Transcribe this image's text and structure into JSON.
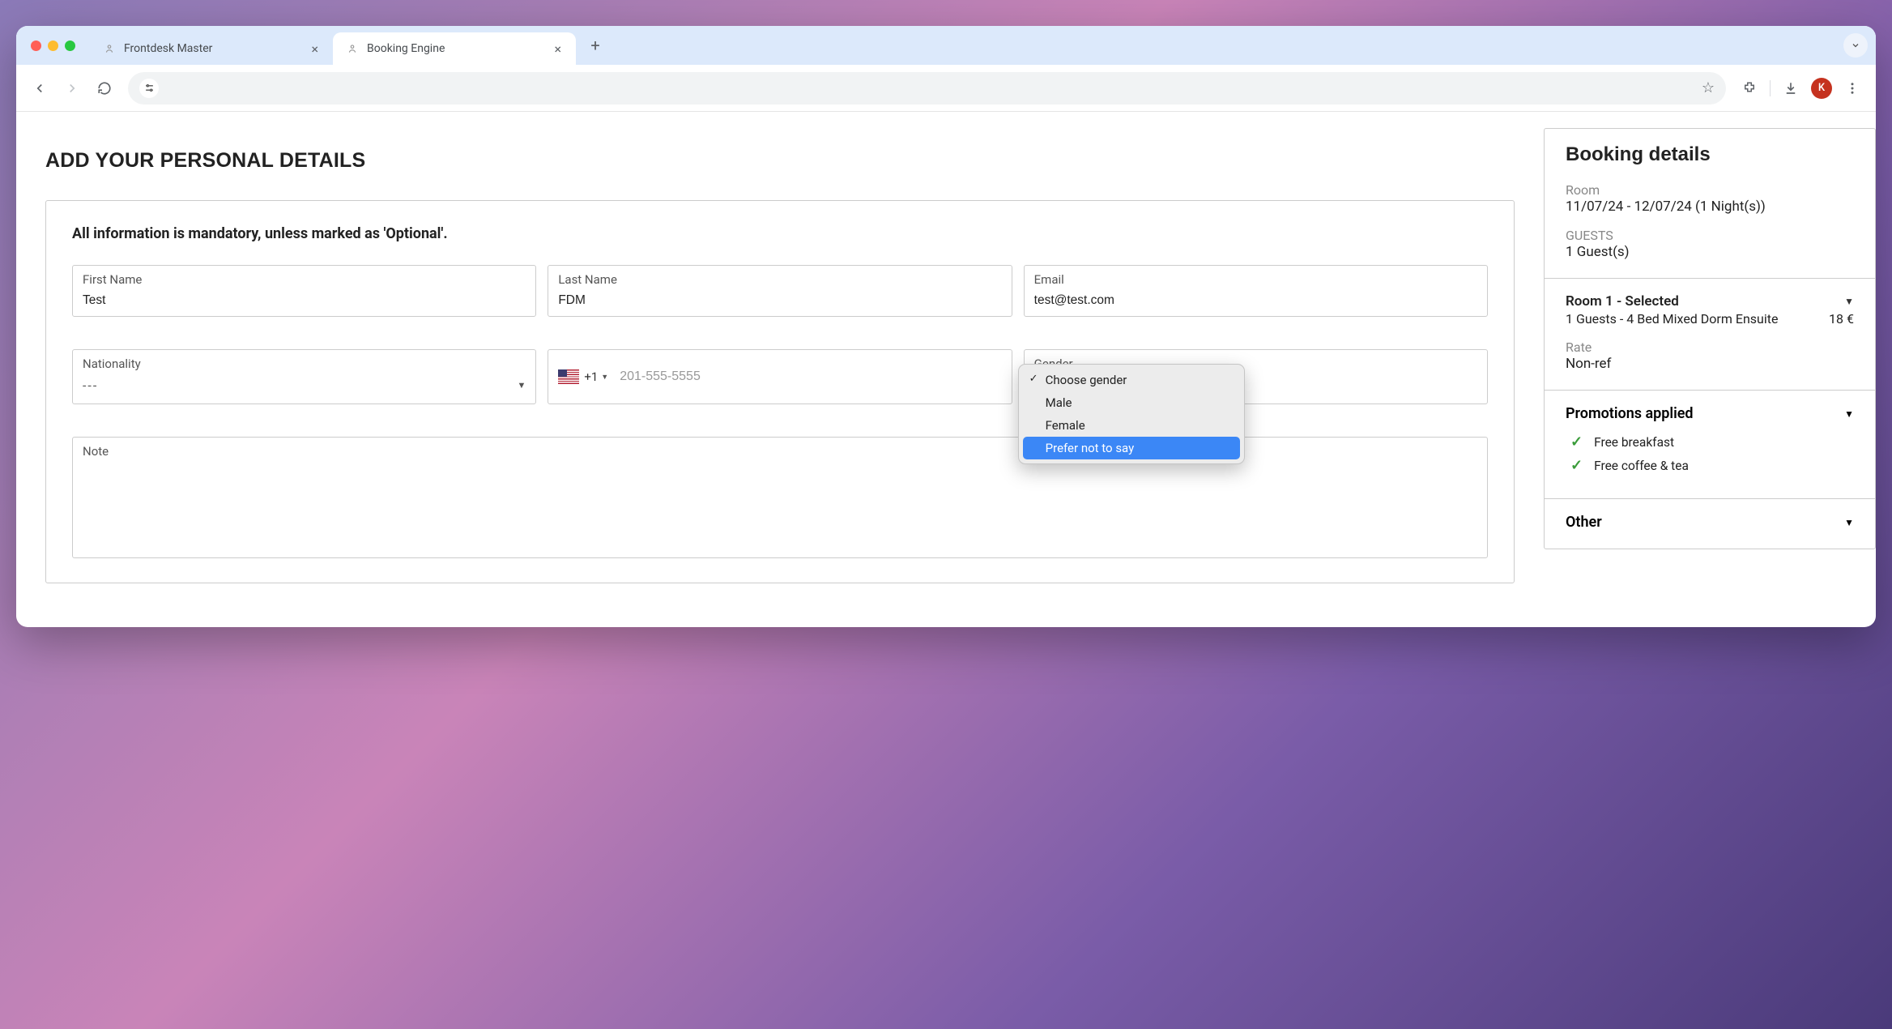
{
  "browser": {
    "tabs": [
      {
        "title": "Frontdesk Master",
        "active": false
      },
      {
        "title": "Booking Engine",
        "active": true
      }
    ],
    "avatar_letter": "K"
  },
  "page": {
    "title": "ADD YOUR PERSONAL DETAILS",
    "form_intro": "All information is mandatory, unless marked as 'Optional'."
  },
  "form": {
    "first_name": {
      "label": "First Name",
      "value": "Test"
    },
    "last_name": {
      "label": "Last Name",
      "value": "FDM"
    },
    "email": {
      "label": "Email",
      "value": "test@test.com"
    },
    "nationality": {
      "label": "Nationality",
      "value": "---"
    },
    "phone": {
      "dial_code": "+1",
      "placeholder": "201-555-5555",
      "value": ""
    },
    "gender": {
      "label": "Gender",
      "options": [
        "Choose gender",
        "Male",
        "Female",
        "Prefer not to say"
      ],
      "selected": "Choose gender",
      "highlighted": "Prefer not to say"
    },
    "note": {
      "label": "Note",
      "value": ""
    }
  },
  "sidebar": {
    "title": "Booking details",
    "room_label": "Room",
    "room_value": "11/07/24 - 12/07/24 (1 Night(s))",
    "guests_label": "GUESTS",
    "guests_value": "1 Guest(s)",
    "room_header": "Room 1 - Selected",
    "room_desc": "1 Guests - 4 Bed Mixed Dorm Ensuite",
    "room_price": "18 €",
    "rate_label": "Rate",
    "rate_value": "Non-ref",
    "promotions_title": "Promotions applied",
    "promotions": [
      "Free breakfast",
      "Free coffee & tea"
    ],
    "other_title": "Other"
  }
}
